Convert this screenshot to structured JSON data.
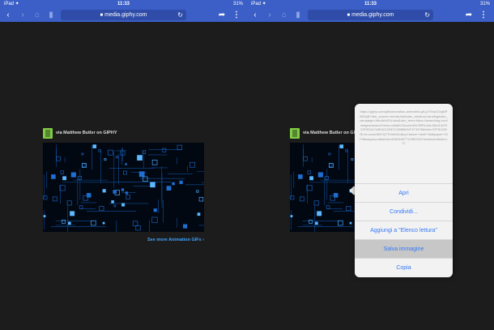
{
  "status": {
    "time": "11:33",
    "battery": "31%",
    "left": "iPad ✦"
  },
  "browser": {
    "url": "media.giphy.com"
  },
  "embed": {
    "via": "via Matthew Butler on GIPHY",
    "see_more": "See more Animation GIFs ›"
  },
  "popup": {
    "url_text": "https://giphy.com/gifs/animation-animated-gif-y1T9vpG1tgNP8D0pB?utm_source=media-link&utm_medium=landing&utm_campaign=Media%20Links&utm_term=https://www.bing.com/images/search?view=detailV2&ccid=BVZMRL&id=BA4CAF520F0D44744E421203CC26B860471F1978&thid=OIP.BVZMRL4e-ecaxhiMYQ77KwEsDd&q=Hacker+shell+Wallpaper+Gif+Background&simid=608044677123819447&selectedIndex=17",
    "items": [
      "Apri",
      "Condividi...",
      "Aggiungi a \"Elenco lettura\"",
      "Salva immagine",
      "Copia"
    ],
    "selected_index": 3
  }
}
